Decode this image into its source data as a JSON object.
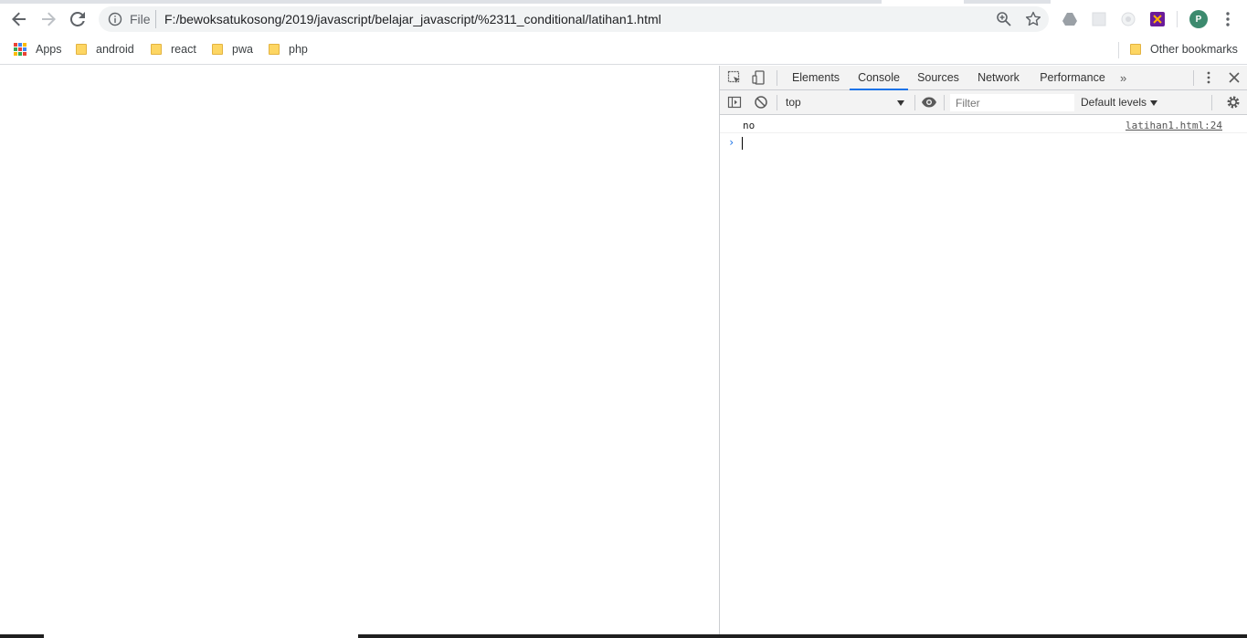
{
  "toolbar": {
    "file_label": "File",
    "url": "F:/bewoksatukosong/2019/javascript/belajar_javascript/%2311_conditional/latihan1.html",
    "profile_initial": "P"
  },
  "bookmarks": {
    "apps_label": "Apps",
    "items": [
      {
        "label": "android"
      },
      {
        "label": "react"
      },
      {
        "label": "pwa"
      },
      {
        "label": "php"
      }
    ],
    "other_label": "Other bookmarks"
  },
  "devtools": {
    "tabs": [
      {
        "label": "Elements"
      },
      {
        "label": "Console"
      },
      {
        "label": "Sources"
      },
      {
        "label": "Network"
      },
      {
        "label": "Performance"
      }
    ],
    "active_tab": "Console",
    "more_tabs_label": "»",
    "context": "top",
    "filter_placeholder": "Filter",
    "levels_label": "Default levels",
    "messages": [
      {
        "text": "no",
        "source": "latihan1.html:24"
      }
    ],
    "prompt_symbol": "›"
  },
  "colors": {
    "accent": "#1a73e8",
    "folder": "#fdd663",
    "profile": "#3c8a6e"
  }
}
